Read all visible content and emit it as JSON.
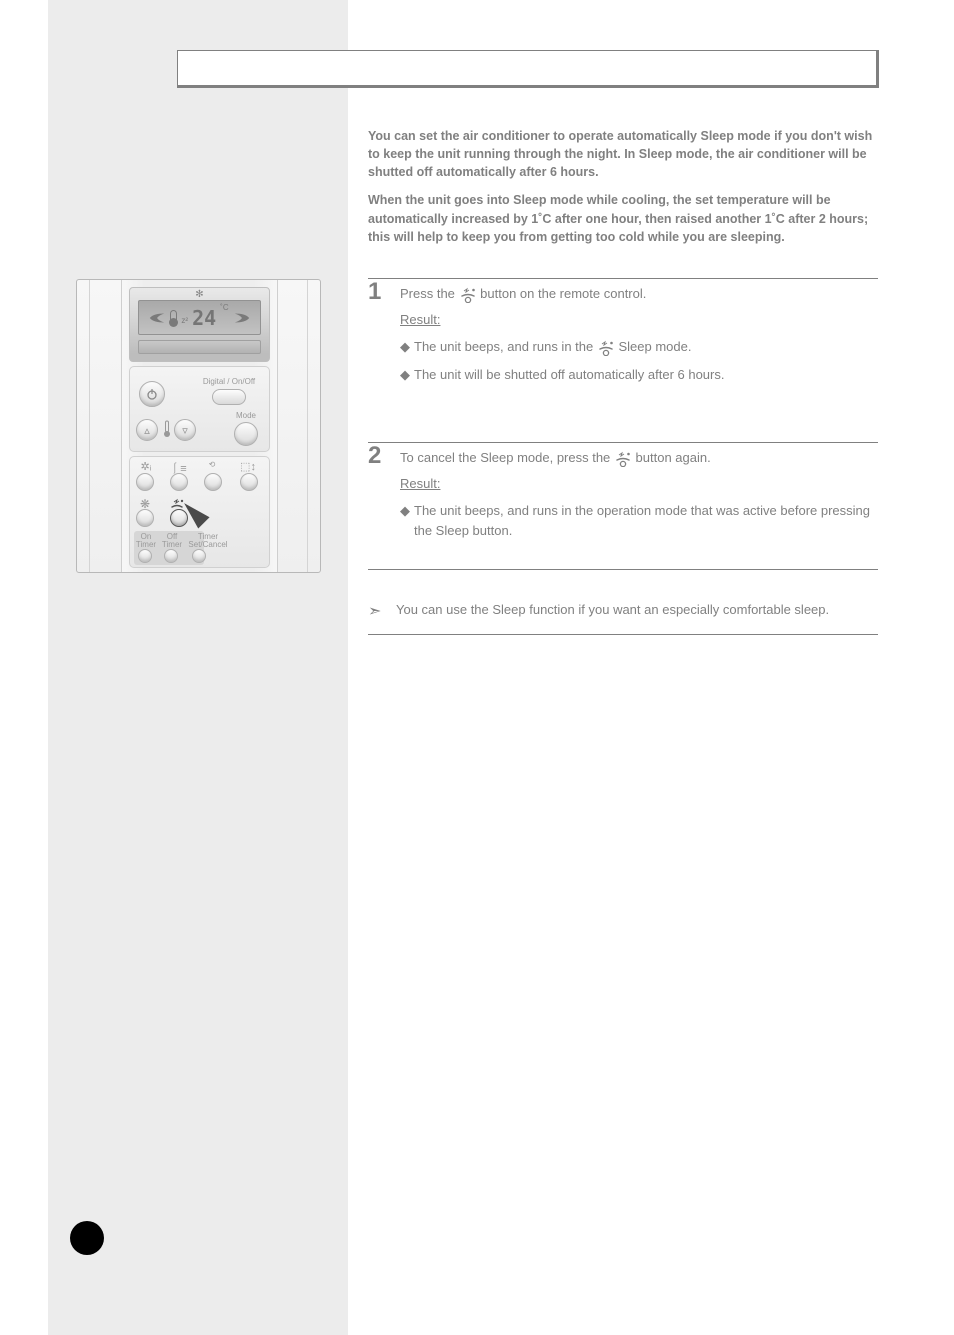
{
  "title": "",
  "intro": {
    "p1": "You can set the air conditioner to operate automatically Sleep mode if you don't wish to keep the unit running through the night. In Sleep mode, the air conditioner will be shutted off automatically after 6 hours.",
    "p2": "When the unit goes into Sleep mode while cooling, the set temperature will be automatically increased by 1˚C after one hour, then raised another 1˚C after 2 hours; this will help to keep you from getting too cold while you are sleeping."
  },
  "remote": {
    "display_temp": "24",
    "unit": "˚C",
    "labels": {
      "digital": "Digital / On/Off",
      "mode": "Mode",
      "on_timer": "On\nTimer",
      "off_timer": "Off\nTimer",
      "set_cancel": "Timer\nSet/Cancel"
    }
  },
  "steps": [
    {
      "num": "1",
      "lead_before": "Press the ",
      "lead_after": " button on the remote control.",
      "result_label": "Result:",
      "bullets": [
        {
          "txt_before": "The unit beeps, and runs in the ",
          "txt_after": " Sleep mode."
        },
        {
          "txt_before": "The unit will be shutted off automatically after 6 hours.",
          "txt_after": ""
        }
      ]
    },
    {
      "num": "2",
      "lead_before": "To cancel the Sleep mode, press the ",
      "lead_after": " button again.",
      "result_label": "Result:",
      "bullets": [
        {
          "txt_before": "The unit beeps, and runs in the operation mode that was active before pressing the Sleep button.",
          "txt_after": ""
        }
      ]
    }
  ],
  "footnote": {
    "symbol": "➣",
    "text": "You can use the Sleep function if you want an especially comfortable sleep."
  },
  "icon_names": {
    "sleep": "sleep-icon"
  },
  "page_number": ""
}
